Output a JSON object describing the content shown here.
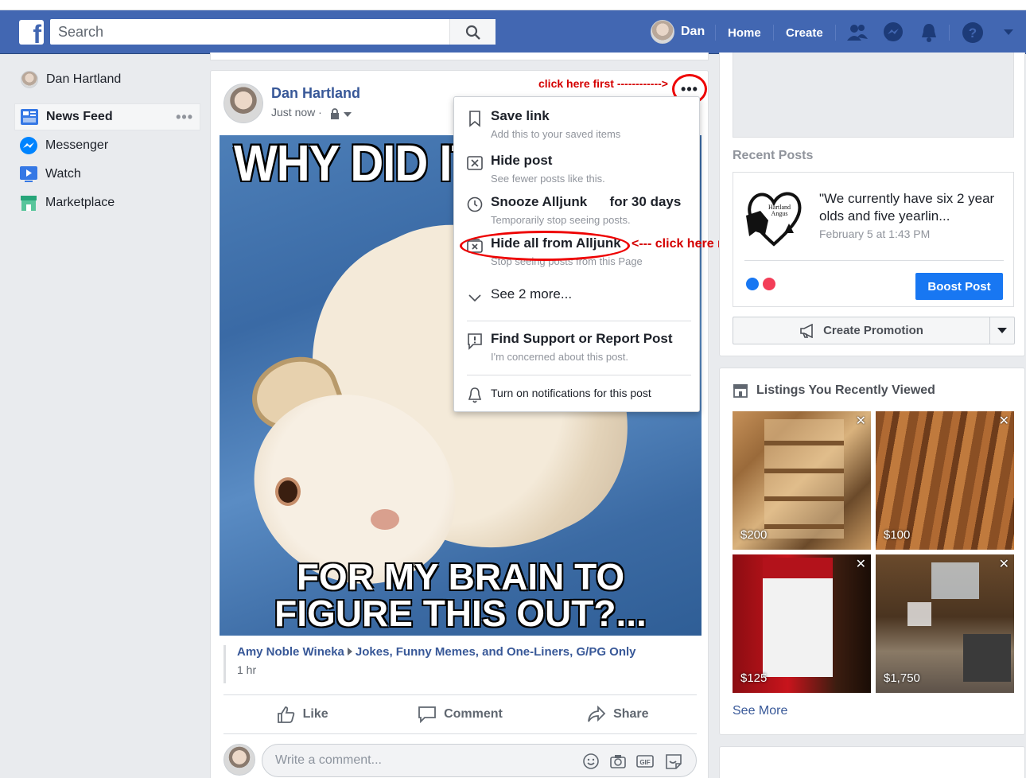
{
  "topbar": {
    "search_placeholder": "Search",
    "user_name": "Dan",
    "home_label": "Home",
    "create_label": "Create"
  },
  "sidebar": {
    "profile_name": "Dan Hartland",
    "items": [
      {
        "label": "News Feed",
        "icon": "news-feed-icon",
        "active": true
      },
      {
        "label": "Messenger",
        "icon": "messenger-icon"
      },
      {
        "label": "Watch",
        "icon": "watch-icon"
      },
      {
        "label": "Marketplace",
        "icon": "marketplace-icon"
      }
    ],
    "more_label": "•••"
  },
  "post": {
    "author": "Dan Hartland",
    "time": "Just now ·",
    "meme_top": "WHY DID IT TA",
    "meme_bottom_1": "FOR MY BRAIN TO",
    "meme_bottom_2": "FIGURE THIS OUT?...",
    "shared_from": "Amy Noble Wineka",
    "shared_group": "Jokes, Funny Memes, and One-Liners, G/PG Only",
    "shared_time": "1 hr",
    "actions": {
      "like": "Like",
      "comment": "Comment",
      "share": "Share"
    },
    "comment_placeholder": "Write a comment...",
    "more_button": "•••"
  },
  "annotations": {
    "first": "click here first ------------>",
    "next": "<--- click here next"
  },
  "menu": {
    "save_title": "Save link",
    "save_sub": "Add this to your saved items",
    "hide_title": "Hide post",
    "hide_sub": "See fewer posts like this.",
    "snooze_title": "Snooze Alljunk      for 30 days",
    "snooze_sub": "Temporarily stop seeing posts.",
    "hideall_title": "Hide all from Alljunk",
    "hideall_sub": "Stop seeing posts from this Page",
    "see_more": "See 2 more...",
    "report_title": "Find Support or Report Post",
    "report_sub": "I'm concerned about this post.",
    "notify": "Turn on notifications for this post"
  },
  "right": {
    "recent_posts_title": "Recent Posts",
    "recent_post_text": "\"We currently have six 2 year olds and five yearlin...",
    "recent_post_date": "February 5 at 1:43 PM",
    "boost_label": "Boost Post",
    "promotion_label": "Create Promotion",
    "listings_title": "Listings You Recently Viewed",
    "listings": [
      {
        "price": "$200"
      },
      {
        "price": "$100"
      },
      {
        "price": "$125"
      },
      {
        "price": "$1,750"
      }
    ],
    "see_more": "See More",
    "logo_text_1": "Hartland",
    "logo_text_2": "Angus"
  },
  "colors": {
    "brand": "#4267b2",
    "link": "#385898",
    "annotation": "#e00000",
    "boost": "#1877f2"
  }
}
